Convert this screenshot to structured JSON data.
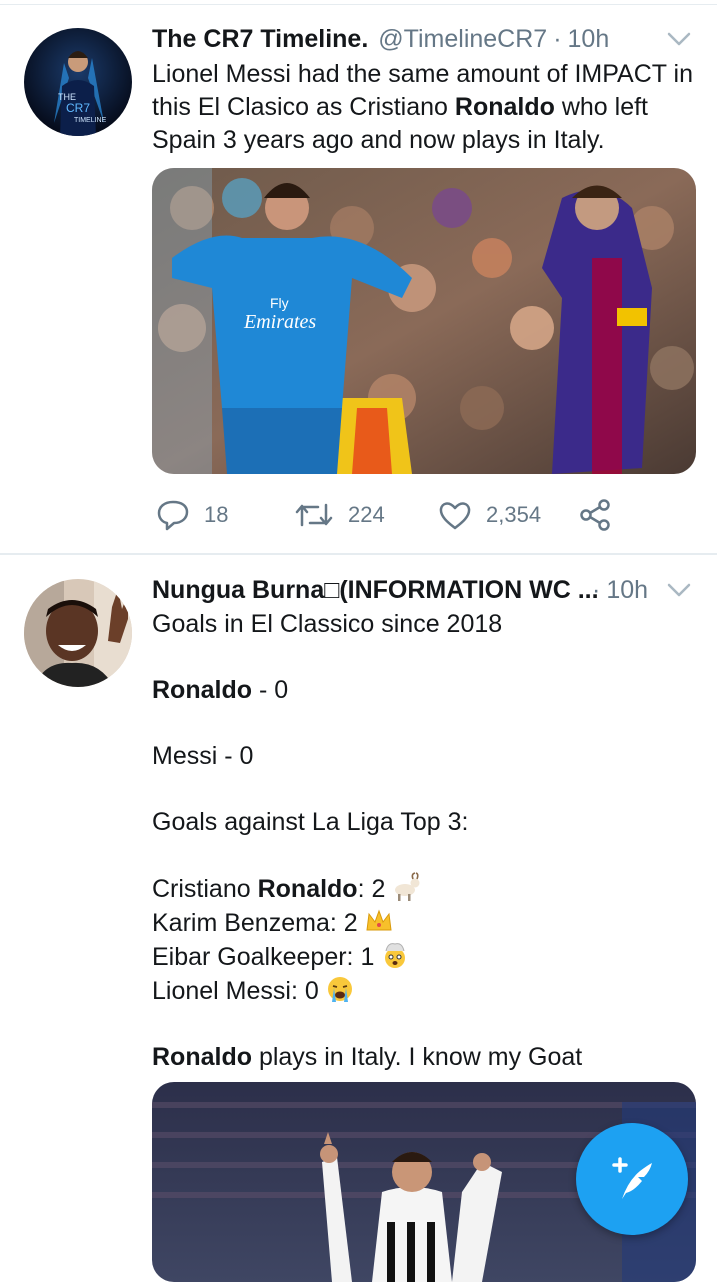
{
  "tweets": [
    {
      "name": "The CR7 Timeline.",
      "handle": "@TimelineCR7",
      "dot": "·",
      "time": "10h",
      "avatar_text": [
        "THE",
        "CR7",
        "TIMELINE"
      ],
      "text_parts": [
        "Lionel Messi had the same amount of IMPACT in this El Clasico as Cristiano ",
        "Ronaldo",
        " who left Spain 3 years ago and now plays in Italy."
      ],
      "media_text": [
        "Fly",
        "Emirates"
      ],
      "actions": {
        "reply_count": "18",
        "retweet_count": "224",
        "like_count": "2,354"
      }
    },
    {
      "name": "Nungua Burna□(INFORMATION WC ...",
      "dot": "·",
      "time": "10h",
      "lines": {
        "l1": "Goals in El Classico since 2018",
        "l2_bold": "Ronaldo",
        "l2_rest": " - 0",
        "l3": "Messi - 0",
        "l4": "Goals against La Liga Top 3:",
        "l5_pre": "Cristiano ",
        "l5_bold": "Ronaldo",
        "l5_rest": ": 2",
        "l6": "Karim Benzema: 2",
        "l7": "Eibar Goalkeeper: 1",
        "l8": "Lionel Messi: 0",
        "l9_bold": "Ronaldo",
        "l9_rest": " plays in Italy. I know my Goat"
      },
      "emojis": [
        "goat-emoji",
        "crown-emoji",
        "exploding-head-emoji",
        "crying-face-emoji"
      ]
    }
  ],
  "fab": {
    "icon": "compose-tweet-icon"
  },
  "colors": {
    "accent": "#1da1f2",
    "secondary_text": "#657786",
    "divider": "#e6ecf0"
  }
}
